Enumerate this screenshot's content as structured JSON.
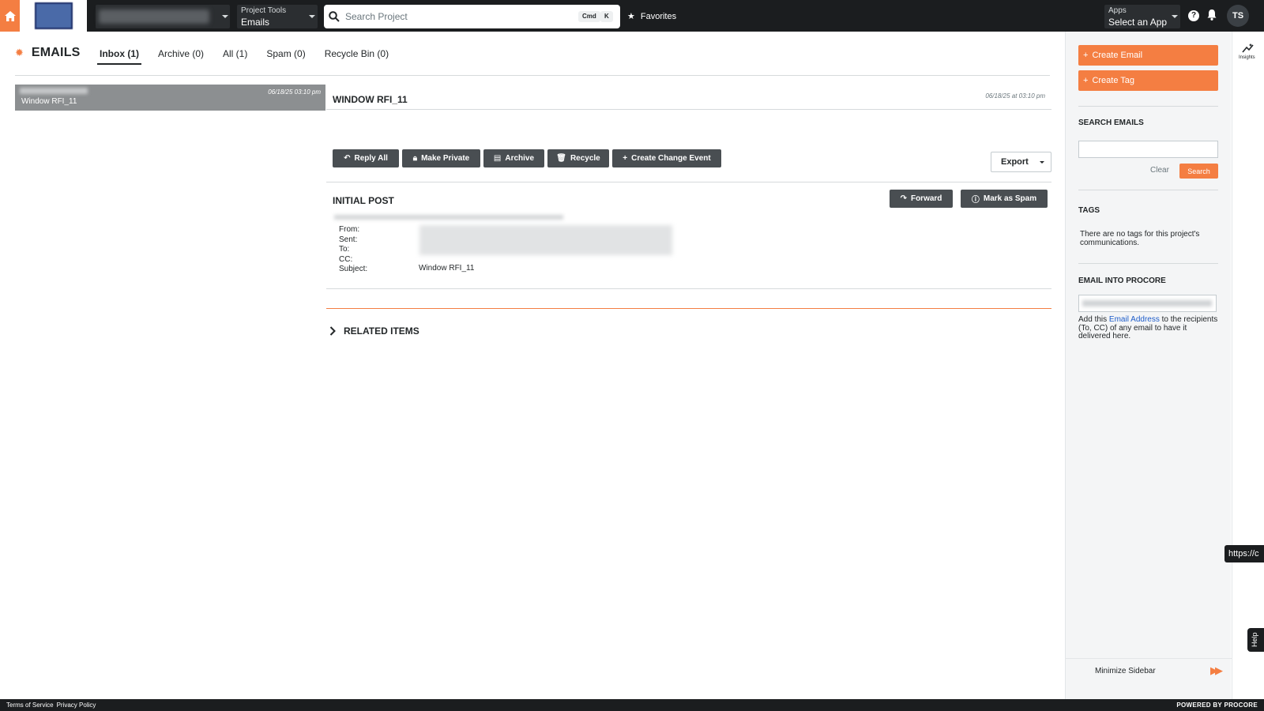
{
  "topbar": {
    "tools_label": "Project Tools",
    "tools_value": "Emails",
    "search_placeholder": "Search Project",
    "kbd_cmd": "Cmd",
    "kbd_k": "K",
    "favorites_label": "Favorites",
    "apps_label": "Apps",
    "apps_value": "Select an App",
    "help_icon": "?",
    "avatar_initials": "TS"
  },
  "page": {
    "title": "EMAILS",
    "tabs": [
      {
        "label": "Inbox (1)",
        "active": true
      },
      {
        "label": "Archive (0)"
      },
      {
        "label": "All (1)"
      },
      {
        "label": "Spam (0)"
      },
      {
        "label": "Recycle Bin (0)"
      }
    ]
  },
  "list": {
    "items": [
      {
        "date": "06/18/25 03:10 pm",
        "subject": "Window RFI_11"
      }
    ]
  },
  "detail": {
    "title": "WINDOW RFI_11",
    "date": "06/18/25 at 03:10 pm",
    "actions": [
      "Reply All",
      "Make Private",
      "Archive",
      "Recycle",
      "Create Change Event"
    ],
    "export_label": "Export",
    "section_title": "INITIAL POST",
    "forward_label": "Forward",
    "spam_label": "Mark as Spam",
    "meta_labels": [
      "From:",
      "Sent:",
      "To:",
      "CC:",
      "Subject:"
    ],
    "subject_value": "Window RFI_11",
    "related_label": "RELATED ITEMS"
  },
  "sidebar": {
    "create_email": "Create Email",
    "create_tag": "Create Tag",
    "search_heading": "SEARCH EMAILS",
    "clear_label": "Clear",
    "search_button": "Search",
    "tags_heading": "TAGS",
    "tags_empty": "There are no tags for this project's communications.",
    "email_into_heading": "EMAIL INTO PROCORE",
    "add_prefix": "Add this ",
    "add_link": "Email Address",
    "add_suffix": " to the recipients (To, CC) of any email to have it delivered here.",
    "minimize_label": "Minimize Sidebar"
  },
  "insights_label": "Insights",
  "url_tooltip": "https://c",
  "help_tab": "Help",
  "footer": {
    "terms": "Terms of Service",
    "privacy": "Privacy Policy",
    "powered": "POWERED BY PROCORE"
  },
  "colors": {
    "accent": "#f47e42",
    "topbar": "#1b1d1f",
    "button_dark": "#494e52"
  }
}
